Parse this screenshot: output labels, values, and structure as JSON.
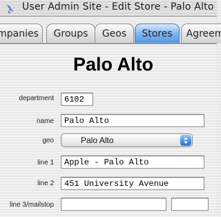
{
  "window": {
    "title": "User Admin Site - Edit Store - Palo Alto"
  },
  "tabs": [
    {
      "label": "mpanies",
      "selected": false
    },
    {
      "label": "Groups",
      "selected": false
    },
    {
      "label": "Geos",
      "selected": false
    },
    {
      "label": "Stores",
      "selected": true
    },
    {
      "label": "Agreem",
      "selected": false
    }
  ],
  "page": {
    "title": "Palo Alto"
  },
  "form": {
    "department": {
      "label": "department",
      "value": "6102"
    },
    "name": {
      "label": "name",
      "value": "Palo Alto"
    },
    "geo": {
      "label": "geo",
      "value": "Palo Alto"
    },
    "line1": {
      "label": "line 1",
      "value": "Apple - Palo Alto"
    },
    "line2": {
      "label": "line 2",
      "value": "451 University Avenue"
    },
    "line3": {
      "label": "line 3/mailstop",
      "value": "",
      "extra_value": ""
    }
  },
  "icons": {
    "app": "app-icon",
    "select_arrows": "updown-arrows-icon"
  },
  "colors": {
    "selected_tab": "#5b99e3",
    "select_arrow": "#4a8ee0"
  }
}
